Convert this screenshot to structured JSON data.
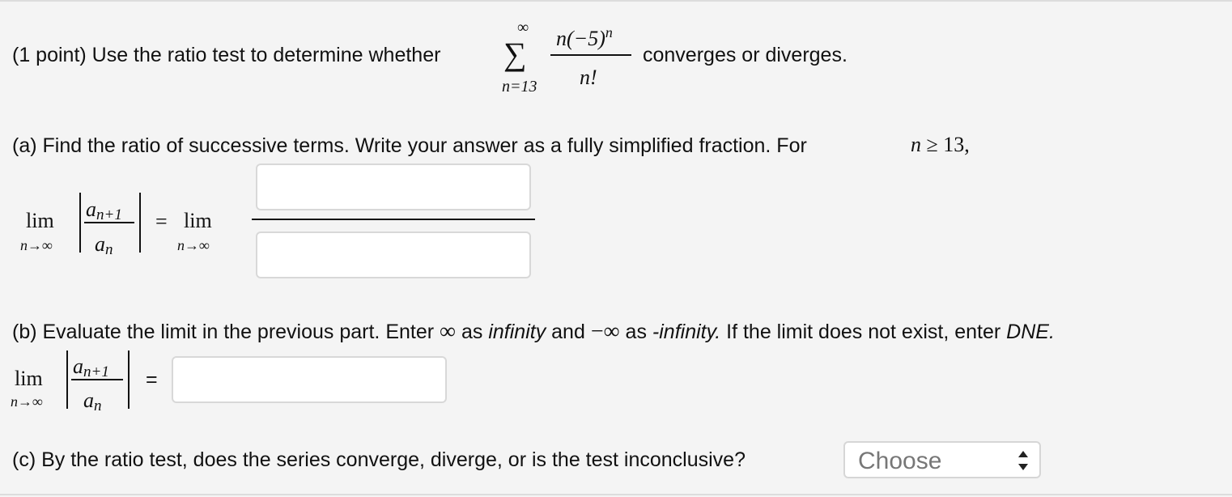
{
  "problem": {
    "prefix": "(1 point) Use the ratio test to determine whether",
    "sum_upper": "∞",
    "sum_symbol": "∑",
    "sum_lower": "n=13",
    "numerator_base": "n(−5)",
    "numerator_exp": "n",
    "denominator": "n!",
    "suffix": "converges or diverges."
  },
  "part_a": {
    "text": "(a) Find the ratio of successive terms. Write your answer as a fully simplified fraction. For",
    "cond_var": "n",
    "cond_op": "≥",
    "cond_val": "13",
    "cond_comma": ",",
    "lim_word": "lim",
    "lim_sub": "n→∞",
    "ratio_num_base": "a",
    "ratio_num_sub": "n+1",
    "ratio_den_base": "a",
    "ratio_den_sub": "n",
    "equals": "=",
    "lim_word_2": "lim",
    "lim_sub_2": "n→∞",
    "numerator_input_value": "",
    "denominator_input_value": ""
  },
  "part_b": {
    "text_1": "(b) Evaluate the limit in the previous part. Enter",
    "infinity_symbol": "∞",
    "text_2": "as",
    "infinity_word": "infinity",
    "text_3": "and",
    "neg_infinity_symbol": "−∞",
    "text_4": "as",
    "neg_infinity_word": "-infinity.",
    "text_5": "If the limit does not exist, enter",
    "dne_word": "DNE.",
    "lim_word": "lim",
    "lim_sub": "n→∞",
    "ratio_num_base": "a",
    "ratio_num_sub": "n+1",
    "ratio_den_base": "a",
    "ratio_den_sub": "n",
    "equals": "=",
    "input_value": ""
  },
  "part_c": {
    "text": "(c) By the ratio test, does the series converge, diverge, or is the test inconclusive?",
    "select_value": "Choose"
  }
}
